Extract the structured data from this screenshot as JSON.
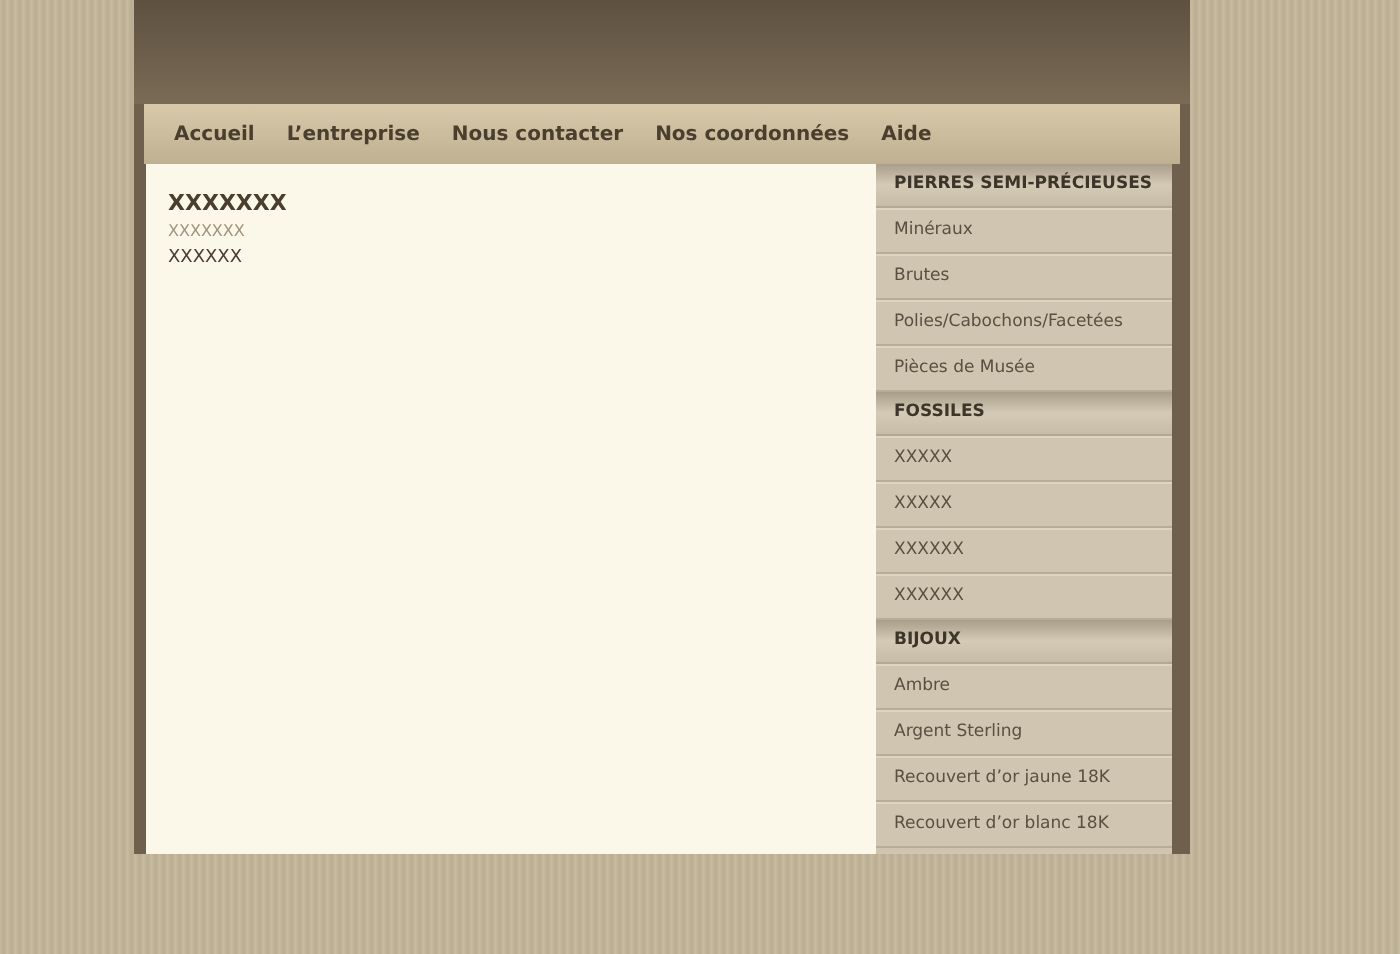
{
  "nav": [
    {
      "label": "Accueil"
    },
    {
      "label": "L’entreprise"
    },
    {
      "label": "Nous contacter"
    },
    {
      "label": "Nos coordonnées"
    },
    {
      "label": "Aide"
    }
  ],
  "content": {
    "title": "XXXXXXX",
    "subtitle": "XXXXXXX",
    "text": "XXXXXX"
  },
  "sidebar": [
    {
      "heading": "PIERRES SEMI-PRÉCIEUSES",
      "items": [
        "Minéraux",
        "Brutes",
        "Polies/Cabochons/Facetées",
        "Pièces de Musée"
      ]
    },
    {
      "heading": "FOSSILES",
      "items": [
        "XXXXX",
        "XXXXX",
        "XXXXXX",
        "XXXXXX"
      ]
    },
    {
      "heading": "BIJOUX",
      "items": [
        "Ambre",
        "Argent Sterling",
        "Recouvert d’or jaune 18K",
        "Recouvert d’or blanc 18K"
      ]
    }
  ]
}
